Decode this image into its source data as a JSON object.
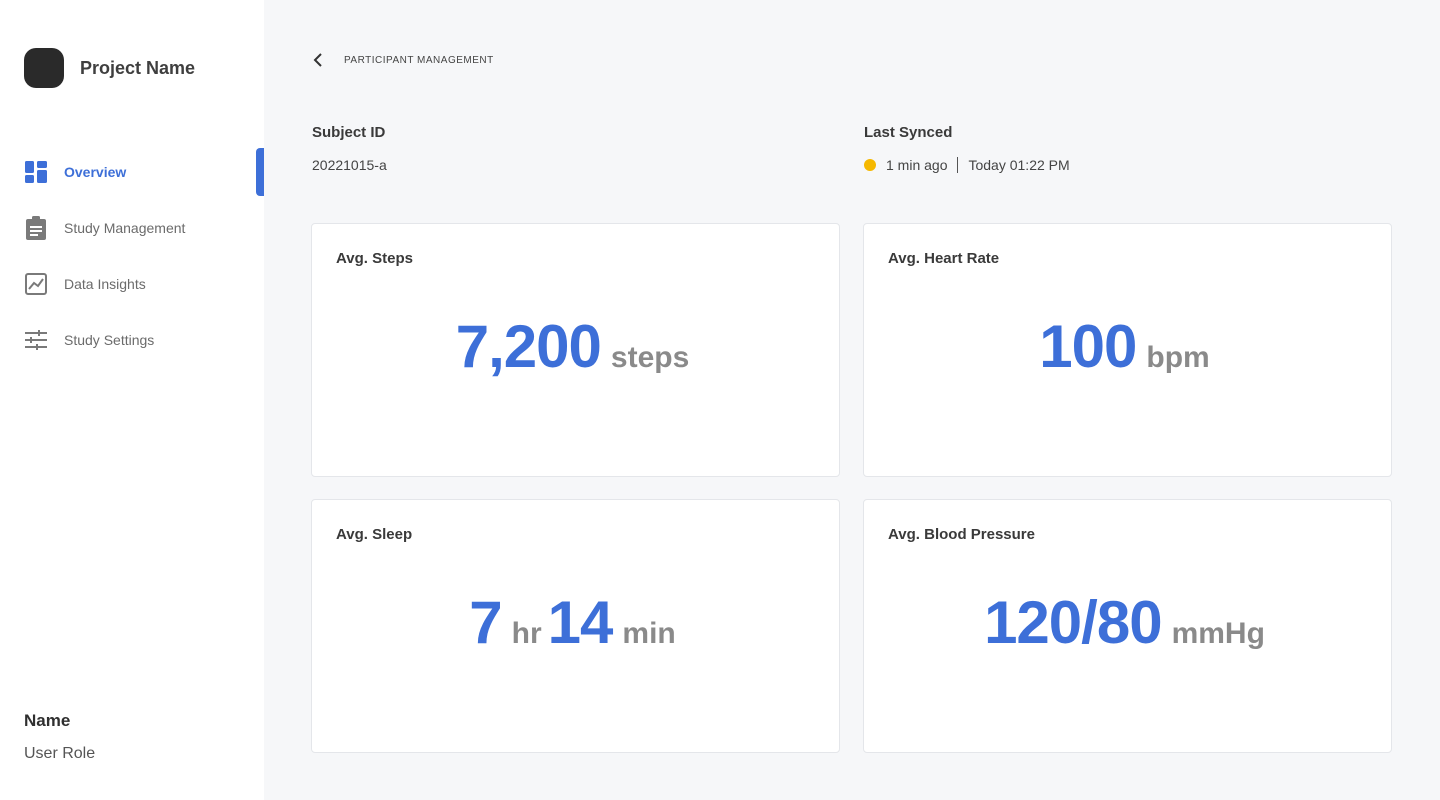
{
  "sidebar": {
    "project_name": "Project Name",
    "nav": [
      {
        "label": "Overview",
        "icon": "dashboard-icon",
        "active": true
      },
      {
        "label": "Study Management",
        "icon": "clipboard-icon",
        "active": false
      },
      {
        "label": "Data Insights",
        "icon": "chart-icon",
        "active": false
      },
      {
        "label": "Study Settings",
        "icon": "sliders-icon",
        "active": false
      }
    ],
    "user": {
      "name": "Name",
      "role": "User Role"
    }
  },
  "breadcrumb": {
    "label": "PARTICIPANT MANAGEMENT"
  },
  "subject": {
    "title": "Subject ID",
    "value": "20221015-a"
  },
  "sync": {
    "title": "Last Synced",
    "ago": "1 min ago",
    "time": "Today 01:22 PM",
    "status_color": "#f5b800"
  },
  "cards": {
    "steps": {
      "title": "Avg. Steps",
      "value": "7,200",
      "unit": "steps"
    },
    "heart": {
      "title": "Avg. Heart Rate",
      "value": "100",
      "unit": "bpm"
    },
    "sleep": {
      "title": "Avg. Sleep",
      "hours": "7",
      "hours_unit": "hr",
      "minutes": "14",
      "minutes_unit": "min"
    },
    "bp": {
      "title": "Avg. Blood Pressure",
      "value": "120/80",
      "unit": "mmHg"
    }
  },
  "colors": {
    "accent": "#3d6fd8",
    "unit_gray": "#8a8a8a"
  }
}
